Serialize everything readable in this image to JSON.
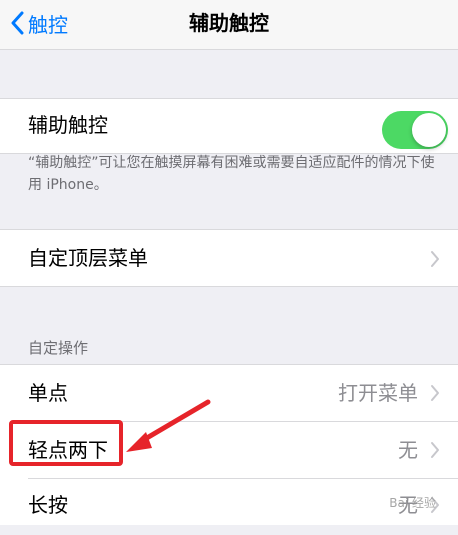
{
  "nav": {
    "back_label": "触控",
    "title": "辅助触控"
  },
  "assistive_touch": {
    "label": "辅助触控",
    "enabled": true,
    "note": "“辅助触控”可让您在触摸屏幕有困难或需要自适应配件的情况下使用 iPhone。",
    "toggle_color": "#4cd964"
  },
  "customize_menu": {
    "label": "自定顶层菜单"
  },
  "custom_actions": {
    "header": "自定操作",
    "items": [
      {
        "label": "单点",
        "value": "打开菜单"
      },
      {
        "label": "轻点两下",
        "value": "无"
      },
      {
        "label": "长按",
        "value": "无"
      }
    ]
  },
  "accent_color": "#007aff",
  "annotation_color": "#e6242a",
  "watermark": "Bai 经验"
}
